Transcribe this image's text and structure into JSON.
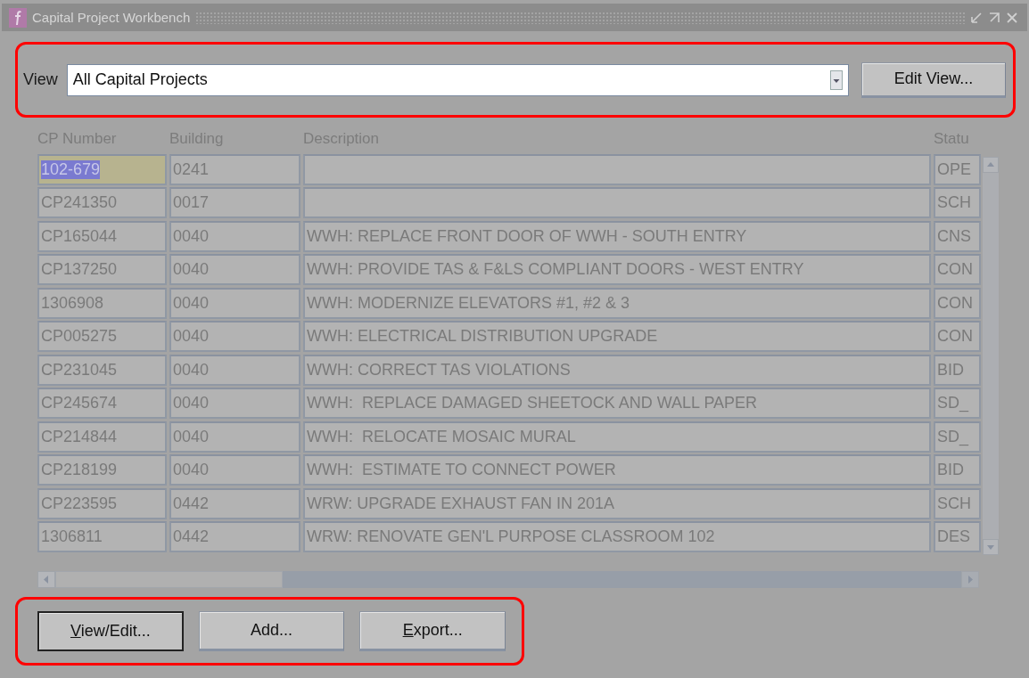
{
  "window": {
    "title": "Capital Project Workbench"
  },
  "view_bar": {
    "highlighted": true,
    "label": "View",
    "value": "All Capital Projects",
    "edit_button": "Edit View..."
  },
  "table": {
    "columns": [
      "CP Number",
      "Building",
      "Description",
      "Statu"
    ],
    "rows": [
      {
        "cp_number": "102-679",
        "building": "0241",
        "description": "",
        "status": "OPE",
        "selected": true
      },
      {
        "cp_number": "CP241350",
        "building": "0017",
        "description": "",
        "status": "SCH",
        "selected": false
      },
      {
        "cp_number": "CP165044",
        "building": "0040",
        "description": "WWH: REPLACE FRONT DOOR OF WWH - SOUTH ENTRY",
        "status": "CNS",
        "selected": false
      },
      {
        "cp_number": "CP137250",
        "building": "0040",
        "description": "WWH: PROVIDE TAS & F&LS COMPLIANT DOORS - WEST ENTRY",
        "status": "CON",
        "selected": false
      },
      {
        "cp_number": "1306908",
        "building": "0040",
        "description": "WWH: MODERNIZE ELEVATORS #1, #2 & 3",
        "status": "CON",
        "selected": false
      },
      {
        "cp_number": "CP005275",
        "building": "0040",
        "description": "WWH: ELECTRICAL DISTRIBUTION UPGRADE",
        "status": "CON",
        "selected": false
      },
      {
        "cp_number": "CP231045",
        "building": "0040",
        "description": "WWH: CORRECT TAS VIOLATIONS",
        "status": "BID",
        "selected": false
      },
      {
        "cp_number": "CP245674",
        "building": "0040",
        "description": "WWH:  REPLACE DAMAGED SHEETOCK AND WALL PAPER",
        "status": "SD_",
        "selected": false
      },
      {
        "cp_number": "CP214844",
        "building": "0040",
        "description": "WWH:  RELOCATE MOSAIC MURAL",
        "status": "SD_",
        "selected": false
      },
      {
        "cp_number": "CP218199",
        "building": "0040",
        "description": "WWH:  ESTIMATE TO CONNECT POWER",
        "status": "BID",
        "selected": false
      },
      {
        "cp_number": "CP223595",
        "building": "0442",
        "description": "WRW: UPGRADE EXHAUST FAN IN 201A",
        "status": "SCH",
        "selected": false
      },
      {
        "cp_number": "1306811",
        "building": "0442",
        "description": "WRW: RENOVATE GEN'L PURPOSE CLASSROOM 102",
        "status": "DES",
        "selected": false
      }
    ]
  },
  "button_bar": {
    "highlighted": true,
    "buttons": [
      {
        "mnemonic": "V",
        "rest": "iew/Edit...",
        "default": true
      },
      {
        "rest": "Add...",
        "default": false
      },
      {
        "mnemonic": "E",
        "rest": "xport...",
        "default": false
      }
    ]
  }
}
